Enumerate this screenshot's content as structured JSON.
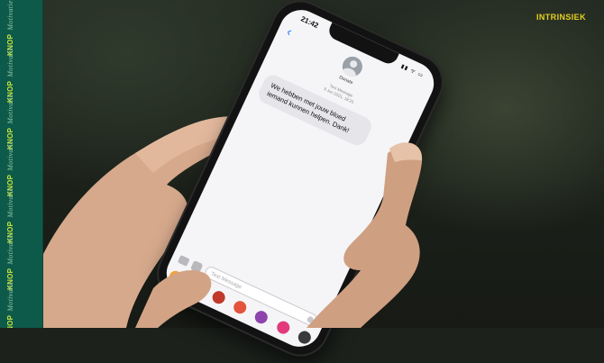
{
  "corner_label": "INTRINSIEK",
  "side_strip": {
    "brand": "KNOP",
    "word": "Motivatie",
    "repeat_count": 7
  },
  "phone": {
    "time": "21:42",
    "status_icons": "▮▮ ᯤ ▭",
    "contact_name": "Donate",
    "thread_header": [
      "Text Message",
      "9 Jun 2021, 18:25"
    ],
    "message": "We hebben met jouw bloed iemand kunnen helpen. Dank!",
    "input_placeholder": "Text Message",
    "app_icons": [
      "photos-icon",
      "appstore-icon",
      "music-icon",
      "memoji-icon",
      "game-icon",
      "stickers-icon",
      "search-icon"
    ],
    "app_icon_colors": [
      "#f2a23a",
      "#1a7cf5",
      "#c0392b",
      "#e4533b",
      "#8e44ad",
      "#e23a7a",
      "#3a3a3c"
    ]
  },
  "colors": {
    "strip": "#0e5a4a",
    "brand": "#c8e63a",
    "corner_label": "#e6d021",
    "imessage_blue": "#1a7cf5",
    "bubble": "#e5e5ea"
  }
}
